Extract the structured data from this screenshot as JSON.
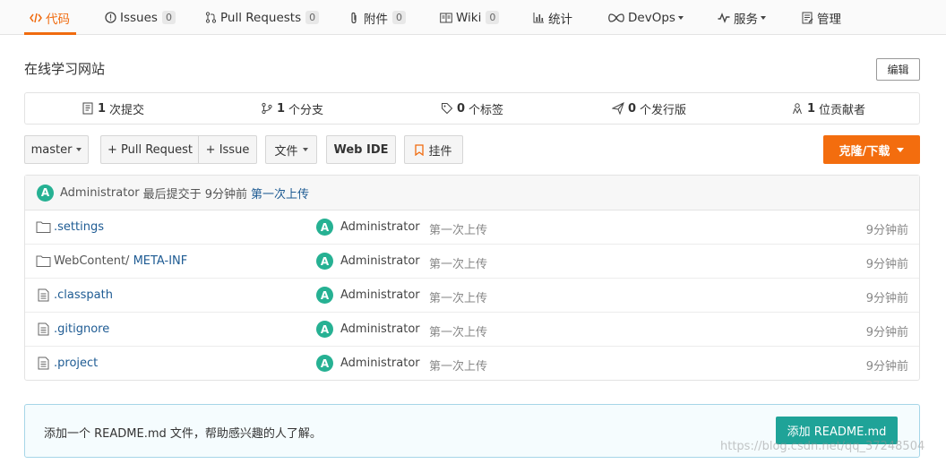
{
  "nav": {
    "tabs": [
      {
        "label": "代码",
        "icon": "code-icon",
        "count": null
      },
      {
        "label": "Issues",
        "icon": "issue-icon",
        "count": "0"
      },
      {
        "label": "Pull Requests",
        "icon": "pull-request-icon",
        "count": "0"
      },
      {
        "label": "附件",
        "icon": "attachment-icon",
        "count": "0"
      },
      {
        "label": "Wiki",
        "icon": "wiki-icon",
        "count": "0"
      },
      {
        "label": "统计",
        "icon": "stats-icon",
        "count": null
      },
      {
        "label": "DevOps",
        "icon": "devops-icon",
        "count": null
      },
      {
        "label": "服务",
        "icon": "service-icon",
        "count": null
      },
      {
        "label": "管理",
        "icon": "manage-icon",
        "count": null
      }
    ],
    "accent": "#f06b0f"
  },
  "repo": {
    "description": "在线学习网站",
    "edit_label": "编辑"
  },
  "stats": {
    "commits": {
      "num": "1",
      "label": "次提交"
    },
    "branches": {
      "num": "1",
      "label": "个分支"
    },
    "tags": {
      "num": "0",
      "label": "个标签"
    },
    "releases": {
      "num": "0",
      "label": "个发行版"
    },
    "contributors": {
      "num": "1",
      "label": "位贡献者"
    }
  },
  "toolbar": {
    "branch": "master",
    "pull_request": "+ Pull Request",
    "issue": "+ Issue",
    "file": "文件",
    "web_ide": "Web IDE",
    "widget": "挂件",
    "clone": "克隆/下载",
    "clone_color": "#f36d0e"
  },
  "latest_commit": {
    "avatar": "A",
    "author": "Administrator",
    "time_text": "最后提交于 9分钟前",
    "message": "第一次上传"
  },
  "files": [
    {
      "dir_prefix": "",
      "name": ".settings",
      "type": "folder",
      "avatar": "A",
      "author": "Administrator",
      "message": "第一次上传",
      "time": "9分钟前"
    },
    {
      "dir_prefix": "WebContent/ ",
      "name": "META-INF",
      "type": "folder",
      "avatar": "A",
      "author": "Administrator",
      "message": "第一次上传",
      "time": "9分钟前"
    },
    {
      "dir_prefix": "",
      "name": ".classpath",
      "type": "file",
      "avatar": "A",
      "author": "Administrator",
      "message": "第一次上传",
      "time": "9分钟前"
    },
    {
      "dir_prefix": "",
      "name": ".gitignore",
      "type": "file",
      "avatar": "A",
      "author": "Administrator",
      "message": "第一次上传",
      "time": "9分钟前"
    },
    {
      "dir_prefix": "",
      "name": ".project",
      "type": "file",
      "avatar": "A",
      "author": "Administrator",
      "message": "第一次上传",
      "time": "9分钟前"
    }
  ],
  "readme": {
    "notice": "添加一个 README.md 文件，帮助感兴趣的人了解。",
    "button": "添加 README.md"
  },
  "watermark": "https://blog.csdn.net/qq_37248504"
}
